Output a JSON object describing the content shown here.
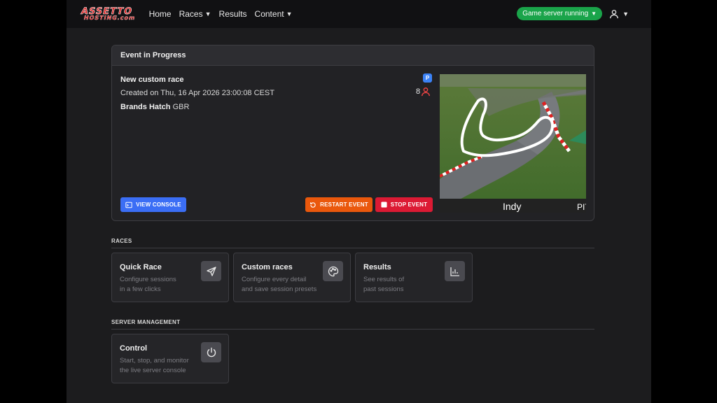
{
  "nav": {
    "logo_line1": "ASSETTO",
    "logo_line2": "HOSTING.com",
    "items": [
      {
        "label": "Home",
        "dropdown": false
      },
      {
        "label": "Races",
        "dropdown": true
      },
      {
        "label": "Results",
        "dropdown": false
      },
      {
        "label": "Content",
        "dropdown": true
      }
    ],
    "server_status": "Game server running",
    "status_color": "#1aa44a"
  },
  "event": {
    "header": "Event in Progress",
    "name": "New custom race",
    "created": "Created on Thu, 16 Apr 2026 23:00:08 CEST",
    "track": "Brands Hatch",
    "country": "GBR",
    "badge": "P",
    "driver_count": "8",
    "preview_label": "Indy",
    "preview_label2": "PIT",
    "buttons": {
      "console": "VIEW CONSOLE",
      "restart": "RESTART EVENT",
      "stop": "STOP EVENT"
    }
  },
  "races_section": {
    "title": "RACES",
    "tiles": [
      {
        "title": "Quick Race",
        "desc1": "Configure sessions",
        "desc2": "in a few clicks",
        "icon": "plane-icon"
      },
      {
        "title": "Custom races",
        "desc1": "Configure every detail",
        "desc2": "and save session presets",
        "icon": "palette-icon"
      },
      {
        "title": "Results",
        "desc1": "See results of",
        "desc2": "past sessions",
        "icon": "chart-icon"
      }
    ]
  },
  "server_section": {
    "title": "SERVER MANAGEMENT",
    "tiles": [
      {
        "title": "Control",
        "desc1": "Start, stop, and monitor",
        "desc2": "the live server console",
        "icon": "power-icon"
      }
    ]
  }
}
